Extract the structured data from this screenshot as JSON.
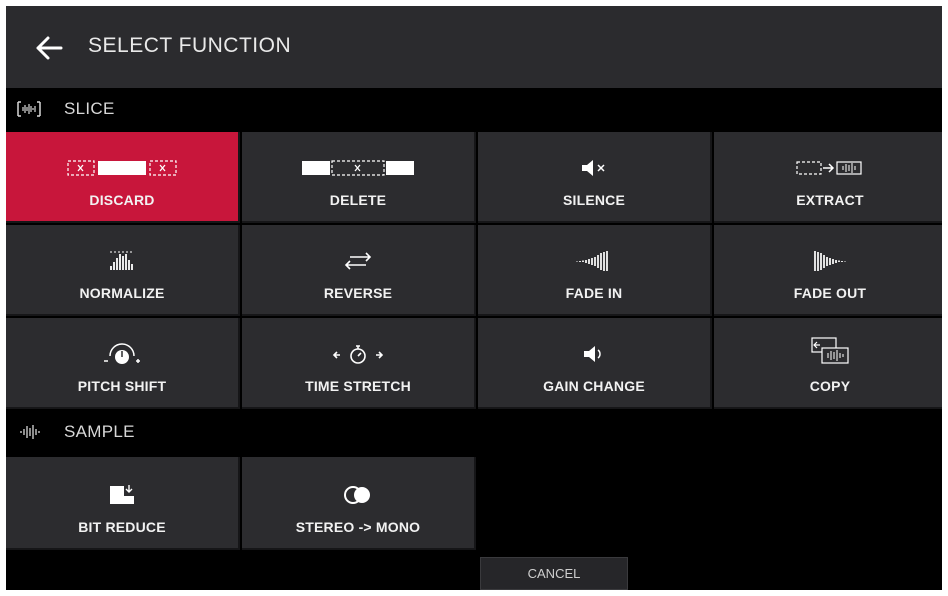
{
  "header": {
    "title": "SELECT FUNCTION",
    "back_icon": "arrow-left-icon"
  },
  "sections": {
    "slice": {
      "label": "SLICE",
      "icon": "waveform-slice-icon"
    },
    "sample": {
      "label": "SAMPLE",
      "icon": "waveform-icon"
    }
  },
  "functions": {
    "discard": {
      "label": "DISCARD",
      "icon": "discard-icon",
      "selected": true
    },
    "delete": {
      "label": "DELETE",
      "icon": "delete-icon"
    },
    "silence": {
      "label": "SILENCE",
      "icon": "speaker-mute-icon"
    },
    "extract": {
      "label": "EXTRACT",
      "icon": "extract-icon"
    },
    "normalize": {
      "label": "NORMALIZE",
      "icon": "normalize-icon"
    },
    "reverse": {
      "label": "REVERSE",
      "icon": "reverse-arrows-icon"
    },
    "fade_in": {
      "label": "FADE IN",
      "icon": "fade-in-icon"
    },
    "fade_out": {
      "label": "FADE OUT",
      "icon": "fade-out-icon"
    },
    "pitch_shift": {
      "label": "PITCH SHIFT",
      "icon": "pitch-knob-icon"
    },
    "time_stretch": {
      "label": "TIME STRETCH",
      "icon": "stopwatch-icon"
    },
    "gain_change": {
      "label": "GAIN CHANGE",
      "icon": "speaker-icon"
    },
    "copy": {
      "label": "COPY",
      "icon": "copy-icon"
    },
    "bit_reduce": {
      "label": "BIT REDUCE",
      "icon": "bit-reduce-icon"
    },
    "stereo_mono": {
      "label": "STEREO -> MONO",
      "icon": "stereo-mono-icon"
    }
  },
  "cancel_label": "CANCEL",
  "colors": {
    "accent": "#c8163b",
    "tile": "#2c2c2f",
    "header": "#2b2b2e",
    "background": "#000000"
  }
}
